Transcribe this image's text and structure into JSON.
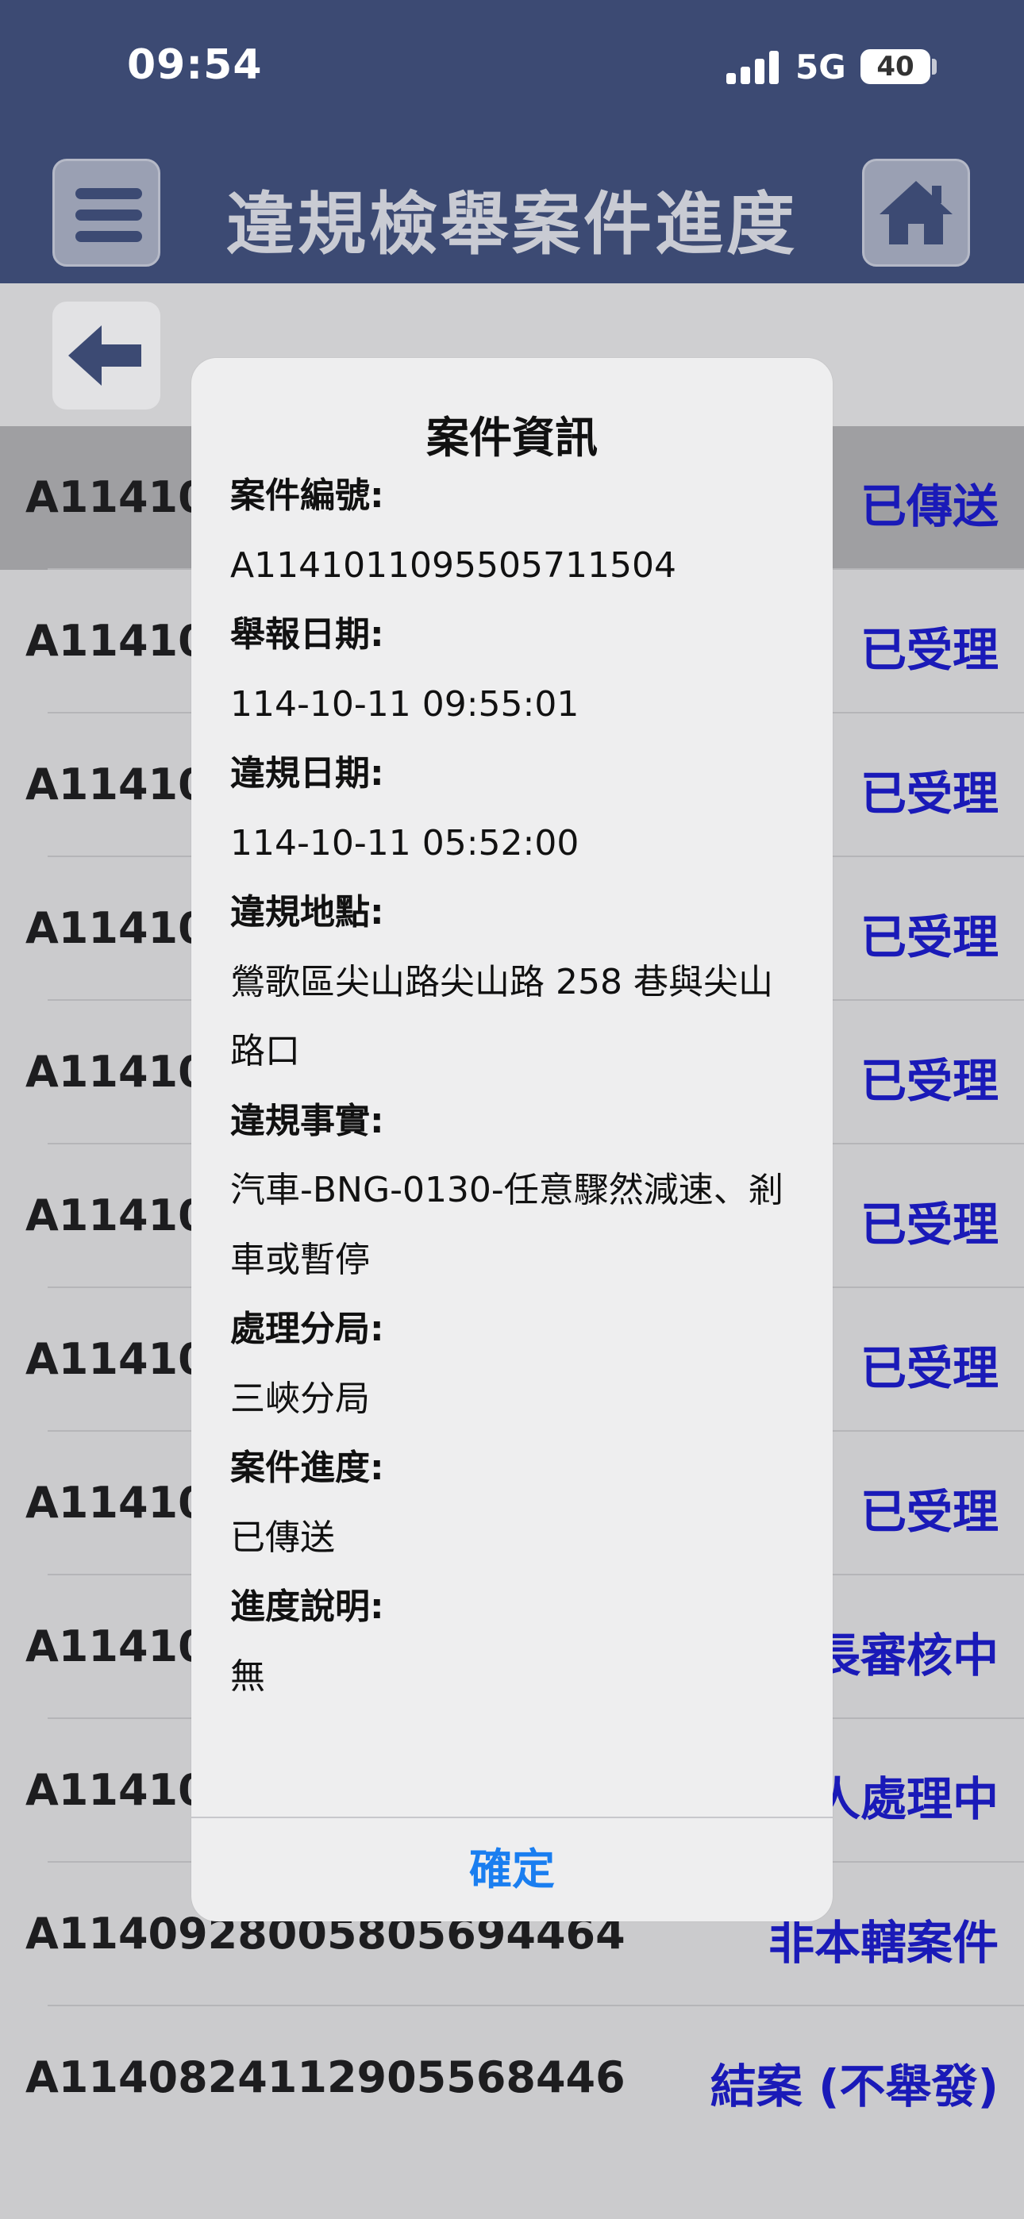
{
  "status_bar": {
    "time": "09:54",
    "network": "5G",
    "battery": "40"
  },
  "header": {
    "title": "違規檢舉案件進度",
    "menu_icon": "hamburger-menu-icon",
    "home_icon": "home-icon"
  },
  "toolbar": {
    "back_icon": "back-arrow-icon"
  },
  "list": [
    {
      "id": "A114101",
      "status": "已傳送",
      "selected": true
    },
    {
      "id": "A114101",
      "status": "已受理"
    },
    {
      "id": "A114101",
      "status": "已受理"
    },
    {
      "id": "A114101",
      "status": "已受理"
    },
    {
      "id": "A114101",
      "status": "已受理"
    },
    {
      "id": "A114101",
      "status": "已受理"
    },
    {
      "id": "A114101",
      "status": "已受理"
    },
    {
      "id": "A114101",
      "status": "已受理"
    },
    {
      "id": "A114100",
      "status": "長審核中"
    },
    {
      "id": "A114100",
      "status": "人處理中"
    },
    {
      "id": "A114092800580569446​4",
      "status": "非本轄案件"
    },
    {
      "id": "A114082411290556844​6",
      "status": "結案 (不舉發)"
    }
  ],
  "dialog": {
    "title": "案件資訊",
    "fields": [
      {
        "label": "案件編號:",
        "value": "A114101109550571150​4"
      },
      {
        "label": "舉報日期:",
        "value": "114-10-11 09:55:01"
      },
      {
        "label": "違規日期:",
        "value": "114-10-11 05:52:00"
      },
      {
        "label": "違規地點:",
        "value": "鶯歌區尖山路尖山路 258 巷與尖山路口"
      },
      {
        "label": "違規事實:",
        "value": "汽車-BNG-0130-任意驟然減速、剎車或暫停"
      },
      {
        "label": "處理分局:",
        "value": "三峽分局"
      },
      {
        "label": "案件進度:",
        "value": "已傳送"
      },
      {
        "label": "進度說明:",
        "value": "無"
      }
    ],
    "confirm_label": "確定"
  },
  "colors": {
    "header_bg": "#3c4a73",
    "status_blue": "#1a1ab8",
    "confirm_blue": "#1a7ef0"
  }
}
